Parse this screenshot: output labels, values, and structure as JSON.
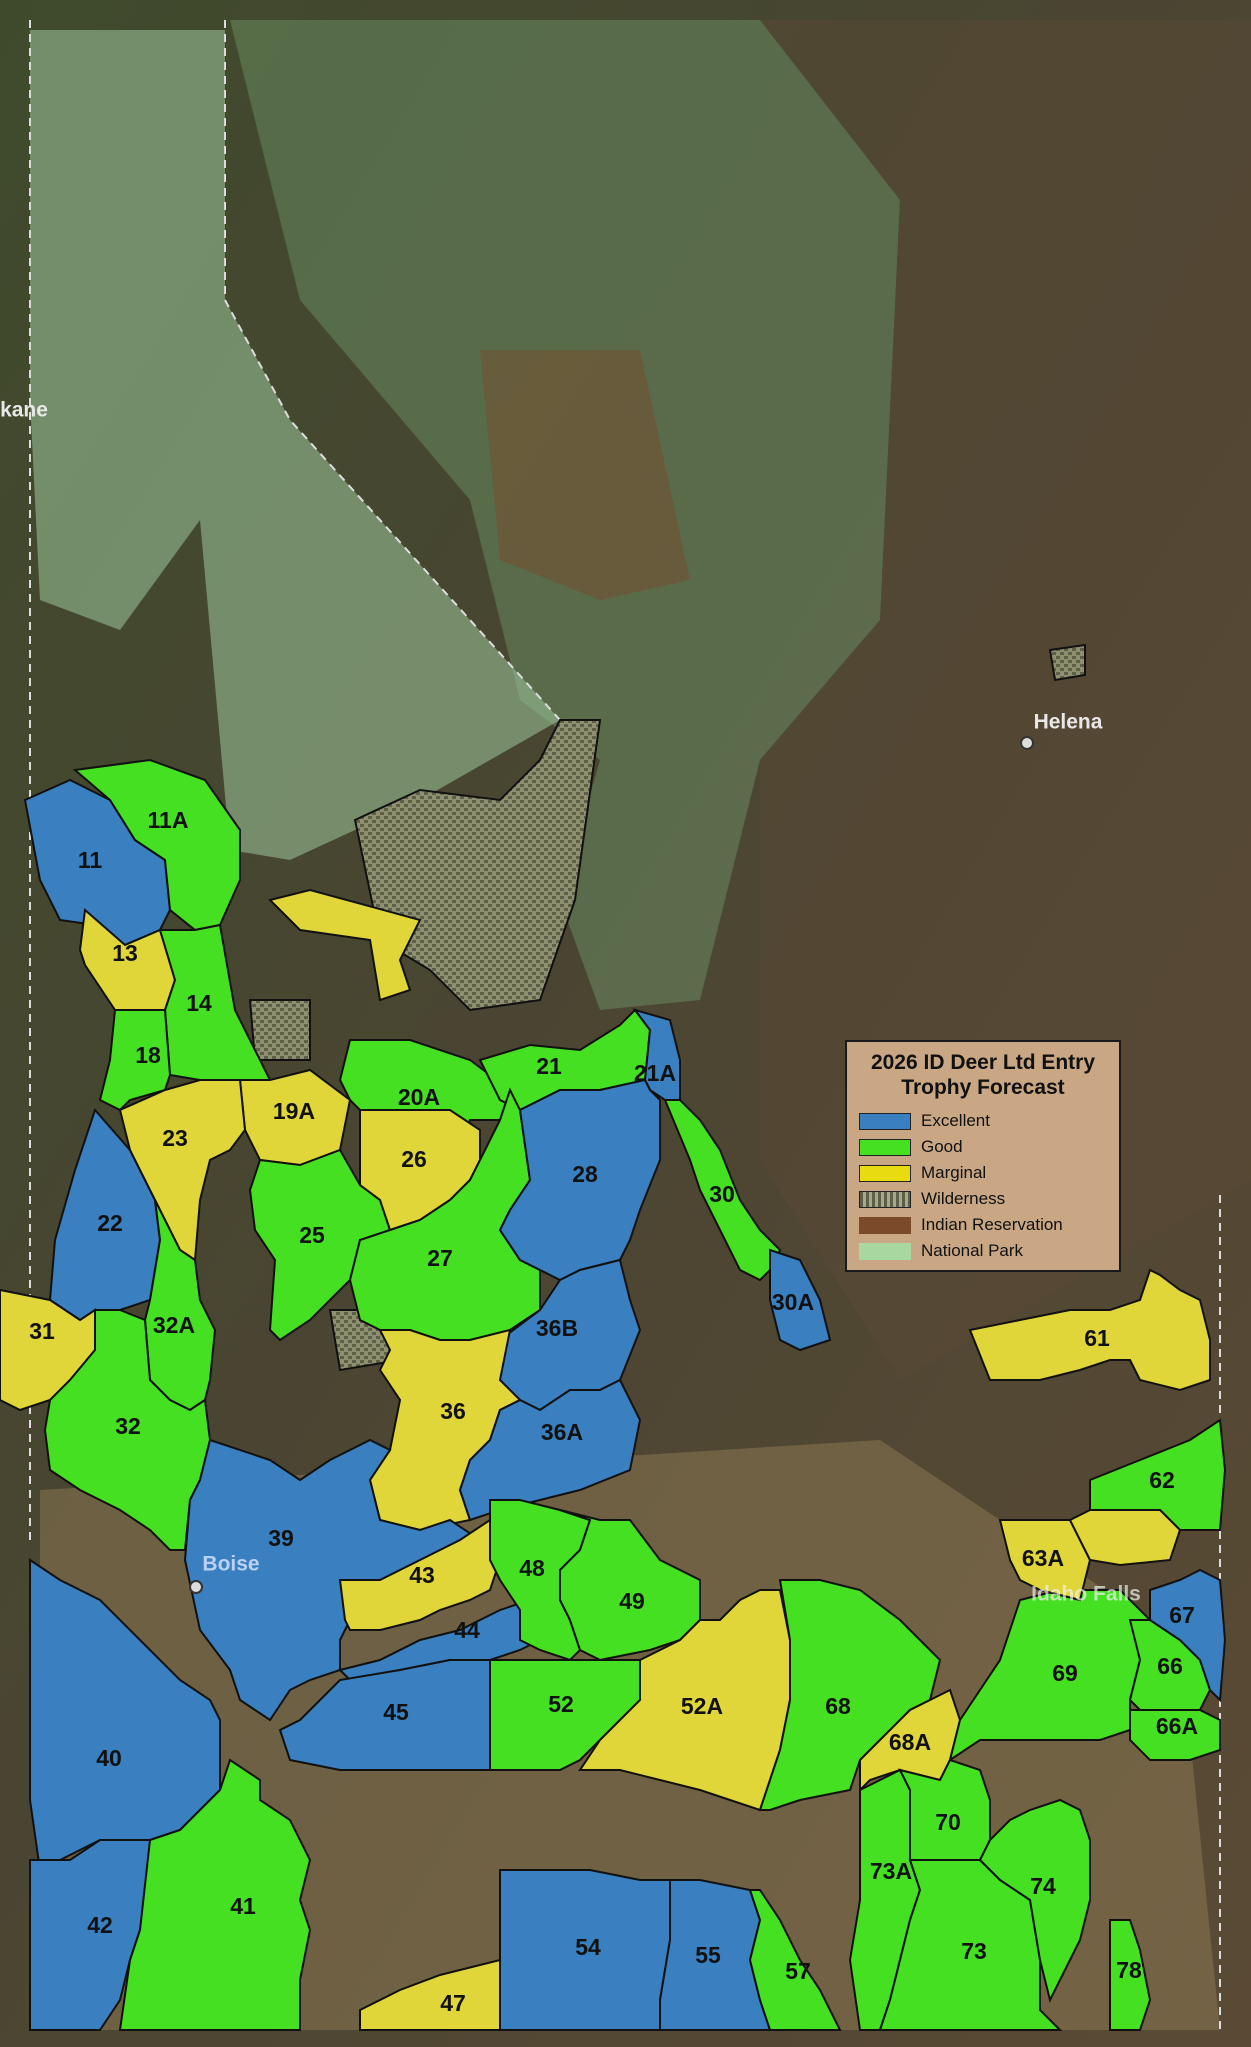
{
  "legend": {
    "title_line1": "2026 ID Deer Ltd Entry",
    "title_line2": "Trophy Forecast",
    "items": [
      {
        "label": "Excellent",
        "color": "#3a7fbf"
      },
      {
        "label": "Good",
        "color": "#44e021"
      },
      {
        "label": "Marginal",
        "color": "#e0d63a"
      },
      {
        "label": "Wilderness",
        "color": "#9a9a7a"
      },
      {
        "label": "Indian Reservation",
        "color": "#7a4a2a"
      },
      {
        "label": "National Park",
        "color": "#a8d8a0"
      }
    ]
  },
  "cities": {
    "spokane": "kane",
    "helena": "Helena",
    "boise": "Boise",
    "idaho_falls": "Idaho Falls"
  },
  "units": [
    {
      "id": "11",
      "rating": "Excellent"
    },
    {
      "id": "11A",
      "rating": "Good"
    },
    {
      "id": "13",
      "rating": "Marginal"
    },
    {
      "id": "14",
      "rating": "Good"
    },
    {
      "id": "18",
      "rating": "Good"
    },
    {
      "id": "19A",
      "rating": "Marginal"
    },
    {
      "id": "20A",
      "rating": "Good"
    },
    {
      "id": "21",
      "rating": "Good"
    },
    {
      "id": "21A",
      "rating": "Excellent"
    },
    {
      "id": "22",
      "rating": "Excellent"
    },
    {
      "id": "23",
      "rating": "Marginal"
    },
    {
      "id": "25",
      "rating": "Good"
    },
    {
      "id": "26",
      "rating": "Marginal"
    },
    {
      "id": "27",
      "rating": "Good"
    },
    {
      "id": "28",
      "rating": "Excellent"
    },
    {
      "id": "30",
      "rating": "Good"
    },
    {
      "id": "30A",
      "rating": "Excellent"
    },
    {
      "id": "31",
      "rating": "Marginal"
    },
    {
      "id": "32",
      "rating": "Good"
    },
    {
      "id": "32A",
      "rating": "Good"
    },
    {
      "id": "36",
      "rating": "Marginal"
    },
    {
      "id": "36A",
      "rating": "Excellent"
    },
    {
      "id": "36B",
      "rating": "Excellent"
    },
    {
      "id": "39",
      "rating": "Excellent"
    },
    {
      "id": "40",
      "rating": "Excellent"
    },
    {
      "id": "41",
      "rating": "Good"
    },
    {
      "id": "42",
      "rating": "Excellent"
    },
    {
      "id": "43",
      "rating": "Marginal"
    },
    {
      "id": "44",
      "rating": "Excellent"
    },
    {
      "id": "45",
      "rating": "Excellent"
    },
    {
      "id": "47",
      "rating": "Marginal"
    },
    {
      "id": "48",
      "rating": "Good"
    },
    {
      "id": "49",
      "rating": "Good"
    },
    {
      "id": "52",
      "rating": "Good"
    },
    {
      "id": "52A",
      "rating": "Marginal"
    },
    {
      "id": "54",
      "rating": "Excellent"
    },
    {
      "id": "55",
      "rating": "Excellent"
    },
    {
      "id": "57",
      "rating": "Good"
    },
    {
      "id": "61",
      "rating": "Marginal"
    },
    {
      "id": "62",
      "rating": "Good"
    },
    {
      "id": "63A",
      "rating": "Marginal"
    },
    {
      "id": "66",
      "rating": "Good"
    },
    {
      "id": "66A",
      "rating": "Good"
    },
    {
      "id": "67",
      "rating": "Excellent"
    },
    {
      "id": "68",
      "rating": "Good"
    },
    {
      "id": "68A",
      "rating": "Marginal"
    },
    {
      "id": "69",
      "rating": "Good"
    },
    {
      "id": "70",
      "rating": "Good"
    },
    {
      "id": "73",
      "rating": "Good"
    },
    {
      "id": "73A",
      "rating": "Good"
    },
    {
      "id": "74",
      "rating": "Good"
    },
    {
      "id": "78",
      "rating": "Good"
    }
  ]
}
